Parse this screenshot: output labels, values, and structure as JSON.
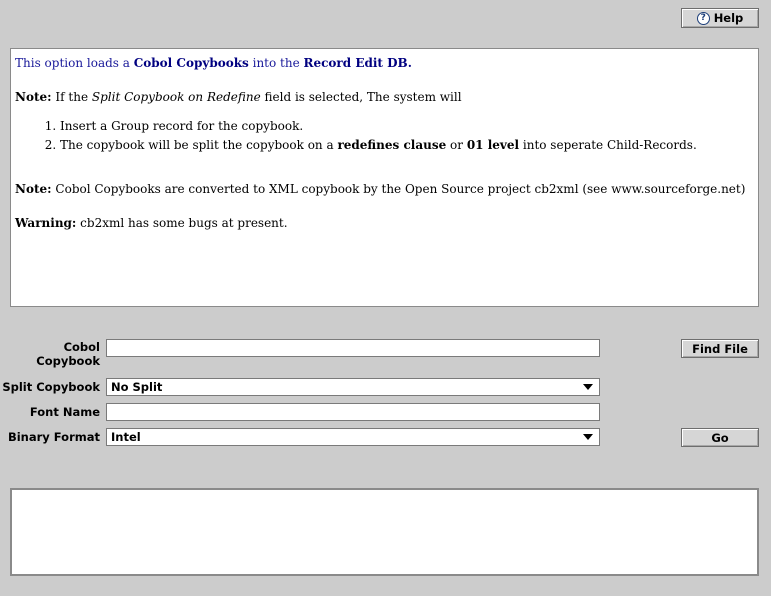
{
  "help_button": {
    "label": "Help",
    "icon": "question-icon"
  },
  "info": {
    "intro_prefix": "This option loads a ",
    "intro_bold1": "Cobol Copybooks",
    "intro_mid": " into the ",
    "intro_bold2": "Record Edit DB.",
    "note1_label": "Note:",
    "note1_prefix": " If the ",
    "note1_italic": "Split Copybook on Redefine",
    "note1_suffix": " field is selected, The system will",
    "list_item1": "Insert a Group record for the copybook.",
    "list_item2_prefix": "The copybook will be split the copybook on a ",
    "list_item2_bold1": "redefines clause",
    "list_item2_mid": " or ",
    "list_item2_bold2": "01 level",
    "list_item2_suffix": " into seperate Child-Records.",
    "note2_label": "Note:",
    "note2_text": " Cobol Copybooks are converted to XML copybook by the Open Source project cb2xml (see www.sourceforge.net)",
    "warning_label": "Warning:",
    "warning_text": " cb2xml has some bugs at present."
  },
  "form": {
    "copybook_label": "Cobol Copybook",
    "copybook_value": "",
    "find_file_label": "Find File",
    "split_label": "Split Copybook",
    "split_value": "No Split",
    "font_label": "Font Name",
    "font_value": "",
    "binary_label": "Binary Format",
    "binary_value": "Intel",
    "go_label": "Go"
  },
  "output": {
    "text": ""
  }
}
